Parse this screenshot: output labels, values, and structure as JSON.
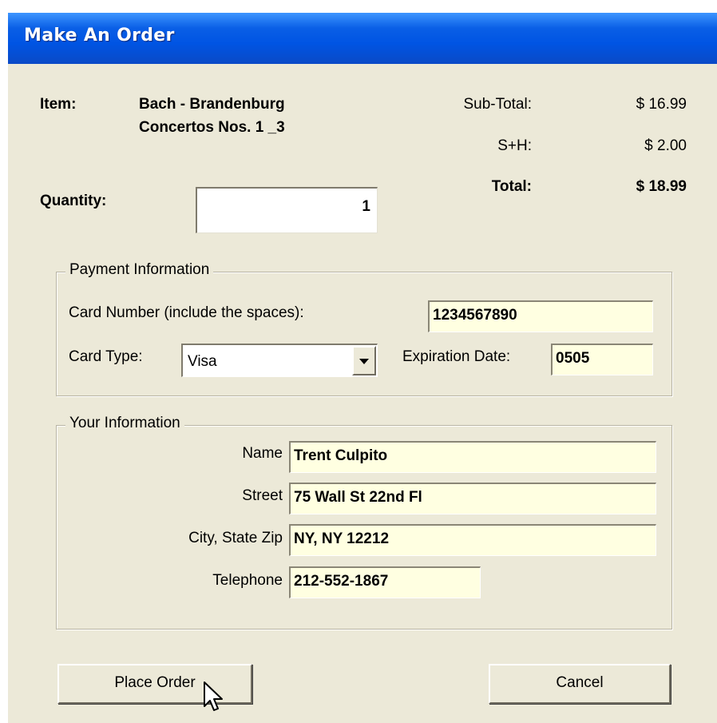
{
  "window": {
    "title": "Make An Order"
  },
  "order": {
    "item_label": "Item:",
    "item_name_line1": "Bach - Brandenburg",
    "item_name_line2": "Concertos Nos. 1 _3",
    "quantity_label": "Quantity:",
    "quantity_value": "1",
    "subtotal_label": "Sub-Total:",
    "subtotal_value": "$ 16.99",
    "sh_label": "S+H:",
    "sh_value": "$ 2.00",
    "total_label": "Total:",
    "total_value": "$ 18.99"
  },
  "payment": {
    "legend": "Payment Information",
    "card_number_label": "Card Number (include the spaces):",
    "card_number_value": "1234567890",
    "card_type_label": "Card Type:",
    "card_type_value": "Visa",
    "expiration_label": "Expiration Date:",
    "expiration_value": "0505"
  },
  "customer": {
    "legend": "Your Information",
    "name_label": "Name",
    "name_value": "Trent Culpito",
    "street_label": "Street",
    "street_value": "75 Wall St 22nd Fl",
    "city_label": "City, State  Zip",
    "city_value": "NY, NY 12212",
    "phone_label": "Telephone",
    "phone_value": "212-552-1867"
  },
  "buttons": {
    "place_order": "Place Order",
    "cancel": "Cancel"
  },
  "colors": {
    "titlebar": "#0054e3",
    "window_bg": "#ece9d8",
    "field_bg": "#ffffe1"
  }
}
